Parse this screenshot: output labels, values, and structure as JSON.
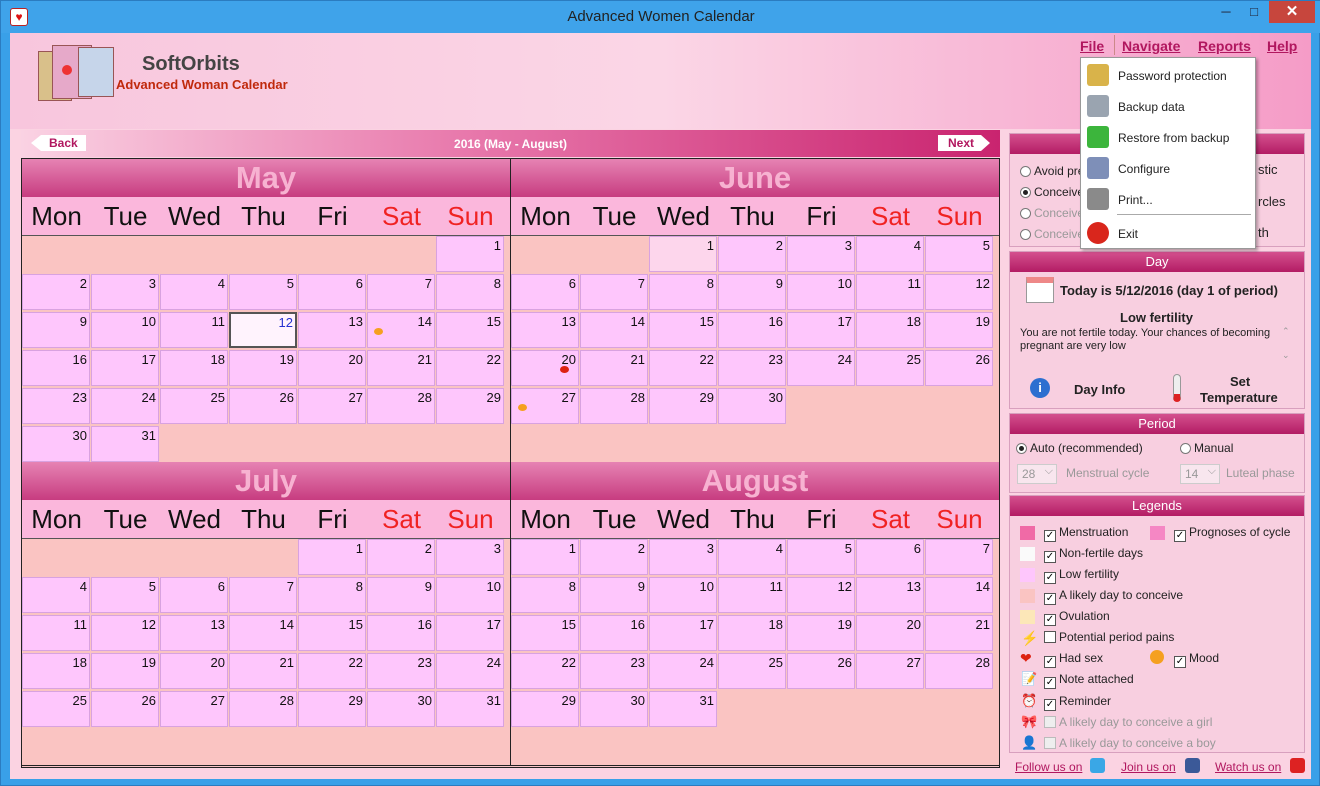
{
  "window": {
    "title": "Advanced Women Calendar"
  },
  "brand": {
    "name": "SoftOrbits",
    "product": "Advanced Woman Calendar"
  },
  "menu": {
    "file": "File",
    "navigate": "Navigate",
    "reports": "Reports",
    "help": "Help"
  },
  "file_menu": {
    "items": [
      "Password protection",
      "Backup data",
      "Restore from backup",
      "Configure",
      "Print...",
      "Exit"
    ]
  },
  "nav": {
    "back": "Back",
    "next": "Next",
    "title": "2016 (May - August)"
  },
  "calendar": {
    "days": [
      "Mon",
      "Tue",
      "Wed",
      "Thu",
      "Fri",
      "Sat",
      "Sun"
    ],
    "months": [
      {
        "name": "May",
        "start": 6,
        "length": 31
      },
      {
        "name": "June",
        "start": 2,
        "length": 30
      },
      {
        "name": "July",
        "start": 4,
        "length": 31
      },
      {
        "name": "August",
        "start": 0,
        "length": 31
      }
    ],
    "today": {
      "month": 0,
      "day": 12
    }
  },
  "mode": {
    "options": [
      "Avoid pre",
      "Conceive",
      "Conceive",
      "Conceive"
    ],
    "right": [
      "stic",
      "rcles",
      "th"
    ]
  },
  "day": {
    "header": "Day",
    "today": "Today is 5/12/2016 (day 1 of period)",
    "fertility": "Low fertility",
    "text": "You are not fertile today. Your chances of becoming pregnant are very low",
    "info": "Day Info",
    "set": "Set",
    "temperature": "Temperature"
  },
  "period": {
    "header": "Period",
    "auto": "Auto (recommended)",
    "manual": "Manual",
    "cycle_value": "28",
    "cycle_label": "Menstrual cycle",
    "luteal_value": "14",
    "luteal_label": "Luteal phase"
  },
  "legends": {
    "header": "Legends",
    "menstruation": "Menstruation",
    "prognoses": "Prognoses of cycle",
    "nonfertile": "Non-fertile days",
    "lowfertility": "Low fertility",
    "likely": "A likely day to conceive",
    "ovulation": "Ovulation",
    "pains": "Potential period pains",
    "sex": "Had sex",
    "mood": "Mood",
    "note": "Note attached",
    "reminder": "Reminder",
    "girl": "A likely day to conceive a girl",
    "boy": "A likely day to conceive a boy"
  },
  "footer": {
    "follow": "Follow us on",
    "join": "Join us on",
    "watch": "Watch us on"
  },
  "colors": {
    "accent": "#b1175f",
    "header": "#c73c80",
    "cell": "#fec6fc",
    "weekend": "#f02222"
  }
}
